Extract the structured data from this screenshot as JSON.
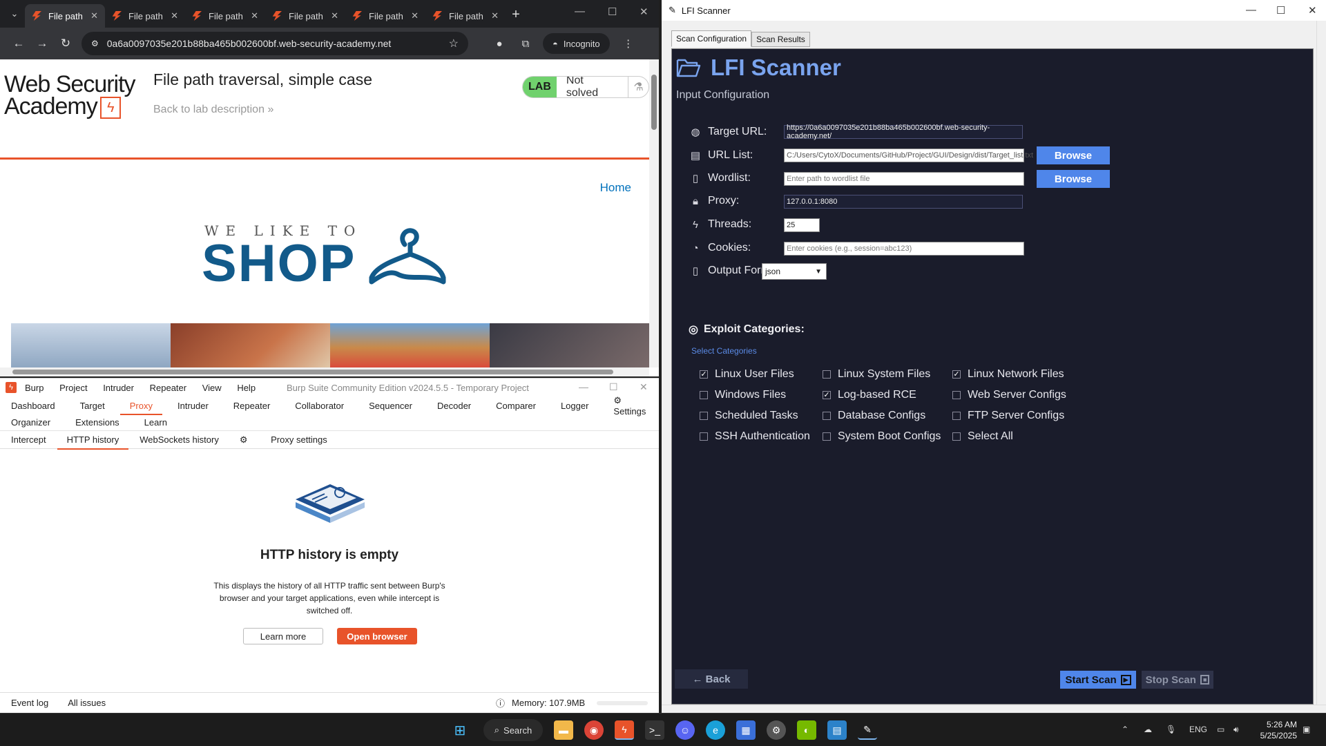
{
  "chrome": {
    "tabs": [
      "File path",
      "File path",
      "File path",
      "File path",
      "File path",
      "File path"
    ],
    "url": "0a6a0097035e201b88ba465b002600bf.web-security-academy.net",
    "incognito_label": "Incognito",
    "page": {
      "logo_line1": "Web Security",
      "logo_line2": "Academy",
      "title": "File path traversal, simple case",
      "back_link": "Back to lab description",
      "lab_label": "LAB",
      "lab_status": "Not solved",
      "home_link": "Home",
      "banner_small": "WE LIKE TO",
      "banner_big": "SHOP"
    }
  },
  "burp": {
    "menu": [
      "Burp",
      "Project",
      "Intruder",
      "Repeater",
      "View",
      "Help"
    ],
    "app_title": "Burp Suite Community Edition v2024.5.5 - Temporary Project",
    "main_tabs": [
      "Dashboard",
      "Target",
      "Proxy",
      "Intruder",
      "Repeater",
      "Collaborator",
      "Sequencer",
      "Decoder",
      "Comparer",
      "Logger"
    ],
    "settings_label": "Settings",
    "main_tabs_row2": [
      "Organizer",
      "Extensions",
      "Learn"
    ],
    "proxy_tabs": [
      "Intercept",
      "HTTP history",
      "WebSockets history"
    ],
    "proxy_settings_label": "Proxy settings",
    "empty_title": "HTTP history is empty",
    "empty_desc": "This displays the history of all HTTP traffic sent between Burp's browser and your target applications, even while intercept is switched off.",
    "learn_more": "Learn more",
    "open_browser": "Open browser",
    "status_event_log": "Event log",
    "status_all_issues": "All issues",
    "memory": "Memory: 107.9MB"
  },
  "lfi": {
    "window_title": "LFI Scanner",
    "tabs": [
      "Scan Configuration",
      "Scan Results"
    ],
    "heading": "LFI Scanner",
    "subheading": "Input Configuration",
    "fields": {
      "target_url_label": "Target URL:",
      "target_url_value": "https://0a6a0097035e201b88ba465b002600bf.web-security-academy.net/",
      "url_list_label": "URL List:",
      "url_list_value": "C:/Users/CytoX/Documents/GitHub/Project/GUI/Design/dist/Target_list.txt",
      "wordlist_label": "Wordlist:",
      "wordlist_placeholder": "Enter path to wordlist file",
      "proxy_label": "Proxy:",
      "proxy_value": "127.0.0.1:8080",
      "threads_label": "Threads:",
      "threads_value": "25",
      "cookies_label": "Cookies:",
      "cookies_placeholder": "Enter cookies (e.g., session=abc123)",
      "output_format_label": "Output Format:",
      "output_format_value": "json"
    },
    "browse_label": "Browse",
    "exploit_title": "Exploit Categories:",
    "select_categories": "Select Categories",
    "categories": [
      {
        "label": "Linux User Files",
        "checked": true
      },
      {
        "label": "Linux System Files",
        "checked": false
      },
      {
        "label": "Linux Network Files",
        "checked": true
      },
      {
        "label": "Windows Files",
        "checked": false
      },
      {
        "label": "Log-based RCE",
        "checked": true
      },
      {
        "label": "Web Server Configs",
        "checked": false
      },
      {
        "label": "Scheduled Tasks",
        "checked": false
      },
      {
        "label": "Database Configs",
        "checked": false
      },
      {
        "label": "FTP Server Configs",
        "checked": false
      },
      {
        "label": "SSH Authentication",
        "checked": false
      },
      {
        "label": "System Boot Configs",
        "checked": false
      },
      {
        "label": "Select All",
        "checked": false
      }
    ],
    "back_label": "← Back",
    "start_label": "Start Scan",
    "stop_label": "Stop Scan",
    "accent": "#4f86ea",
    "panel_bg": "#1a1c2b"
  },
  "taskbar": {
    "search_label": "Search",
    "lang": "ENG",
    "time": "5:26 AM",
    "date": "5/25/2025"
  }
}
